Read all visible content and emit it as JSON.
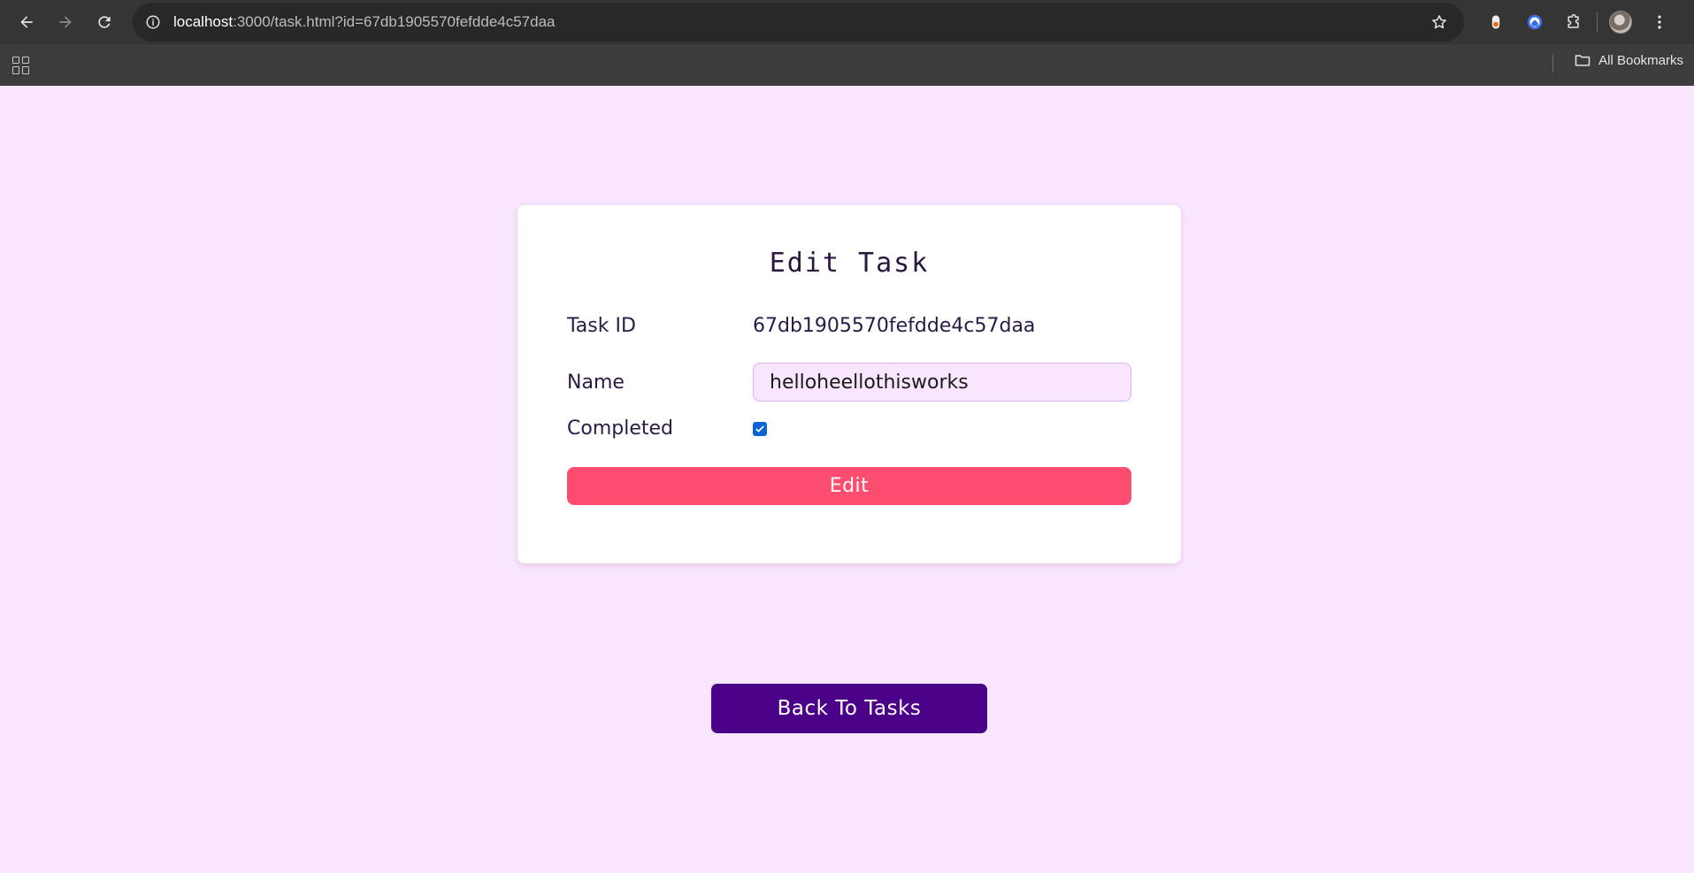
{
  "browser": {
    "url_host": "localhost",
    "url_rest": ":3000/task.html?id=67db1905570fefdde4c57daa",
    "bookmarks_label": "All Bookmarks"
  },
  "card": {
    "title": "Edit Task",
    "task_id_label": "Task ID",
    "task_id_value": "67db1905570fefdde4c57daa",
    "name_label": "Name",
    "name_value": "helloheellothisworks",
    "completed_label": "Completed",
    "completed_checked": true,
    "edit_button": "Edit"
  },
  "back_button": "Back To Tasks",
  "colors": {
    "page_bg": "#f7e6fd",
    "edit_button": "#ff4d70",
    "back_button": "#4c0189",
    "checkbox": "#0b63d6"
  }
}
